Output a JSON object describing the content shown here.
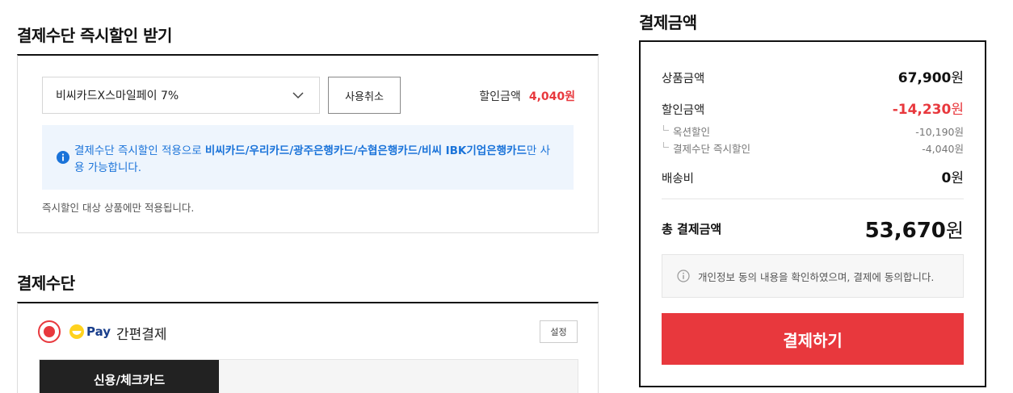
{
  "discount_section": {
    "title": "결제수단 즉시할인 받기",
    "selected_card": "비씨카드X스마일페이 7%",
    "cancel_label": "사용취소",
    "discount_amount_label": "할인금액",
    "discount_amount_value": "4,040원",
    "notice_prefix": "결제수단 즉시할인 적용으로 ",
    "notice_highlight": "비씨카드/우리카드/광주은행카드/수협은행카드/비씨 IBK기업은행카드",
    "notice_suffix": "만 사용 가능합니다.",
    "note": "즉시할인 대상 상품에만 적용됩니다."
  },
  "payment_section": {
    "title": "결제수단",
    "logo_text": "Pay",
    "method_title": "간편결제",
    "setting_label": "설정",
    "active_tab": "신용/체크카드"
  },
  "summary": {
    "title": "결제금액",
    "product_label": "상품금액",
    "product_value": "67,900",
    "discount_label": "할인금액",
    "discount_value": "-14,230",
    "auction_discount_label": "옥션할인",
    "auction_discount_value": "-10,190원",
    "instant_discount_label": "결제수단 즉시할인",
    "instant_discount_value": "-4,040원",
    "shipping_label": "배송비",
    "shipping_value": "0",
    "total_label": "총 결제금액",
    "total_value": "53,670",
    "currency": "원",
    "consent_text": "개인정보 동의 내용을 확인하였으며, 결제에 동의합니다.",
    "pay_button": "결제하기"
  },
  "colors": {
    "accent": "#e8383d",
    "link_blue": "#1a73d9",
    "notice_bg": "#eef5fd"
  },
  "icons": [
    "chevron-down-icon",
    "info-icon",
    "smile-logo-icon",
    "info-circle-icon"
  ]
}
